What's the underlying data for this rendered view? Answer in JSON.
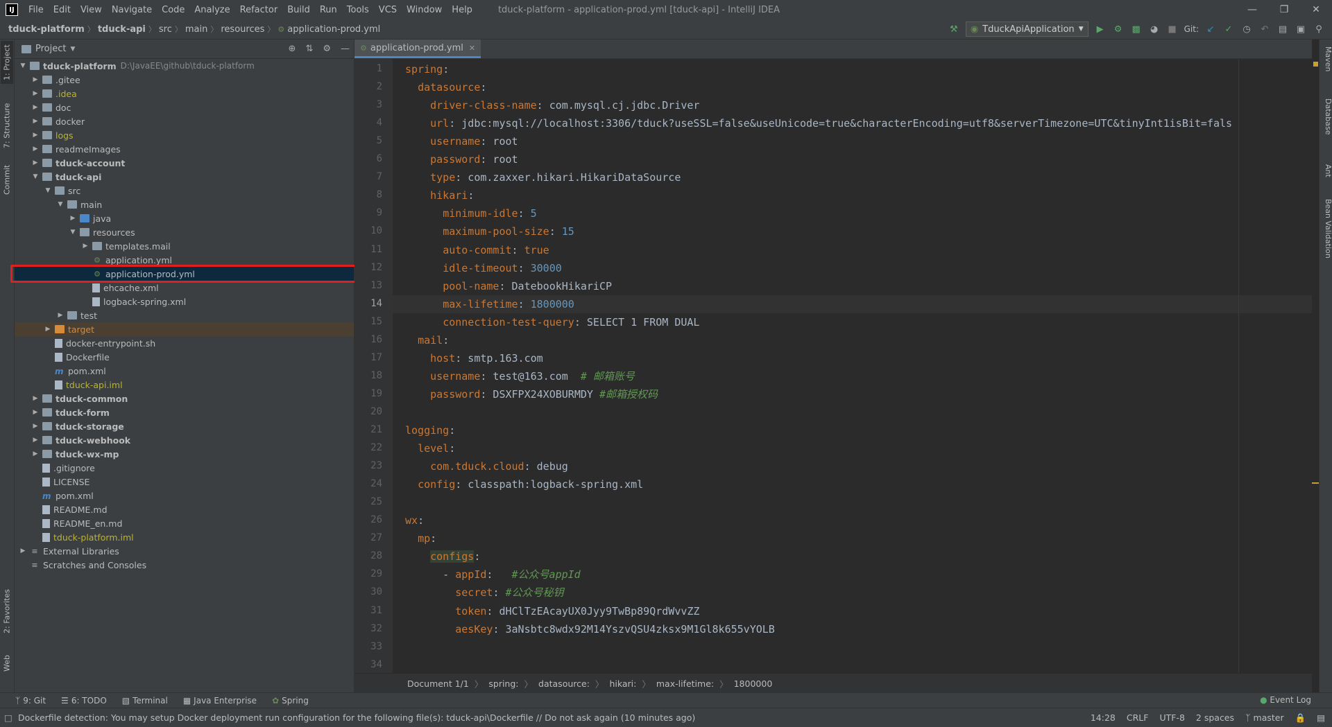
{
  "window": {
    "logo": "IJ",
    "title": "tduck-platform - application-prod.yml [tduck-api] - IntelliJ IDEA",
    "menu": [
      "File",
      "Edit",
      "View",
      "Navigate",
      "Code",
      "Analyze",
      "Refactor",
      "Build",
      "Run",
      "Tools",
      "VCS",
      "Window",
      "Help"
    ]
  },
  "navbar": {
    "crumbs": [
      "tduck-platform",
      "tduck-api",
      "src",
      "main",
      "resources",
      "application-prod.yml"
    ],
    "run_config": "TduckApiApplication",
    "git_label": "Git:"
  },
  "left_strip": {
    "tabs": [
      "1: Project",
      "7: Structure",
      "Commit",
      "2: Favorites",
      "Web"
    ]
  },
  "right_strip": {
    "tabs": [
      "Maven",
      "Database",
      "Ant",
      "Bean Validation"
    ]
  },
  "project": {
    "title": "Project",
    "tree": [
      {
        "depth": 0,
        "arrow": "open",
        "icon": "folder",
        "name": "tduck-platform",
        "style": "bold",
        "extra": "D:\\JavaEE\\github\\tduck-platform"
      },
      {
        "depth": 1,
        "arrow": "closed",
        "icon": "folder",
        "name": ".gitee"
      },
      {
        "depth": 1,
        "arrow": "closed",
        "icon": "folder",
        "name": ".idea",
        "style": "olive"
      },
      {
        "depth": 1,
        "arrow": "closed",
        "icon": "folder",
        "name": "doc"
      },
      {
        "depth": 1,
        "arrow": "closed",
        "icon": "folder",
        "name": "docker"
      },
      {
        "depth": 1,
        "arrow": "closed",
        "icon": "folder",
        "name": "logs",
        "style": "olive"
      },
      {
        "depth": 1,
        "arrow": "closed",
        "icon": "folder",
        "name": "readmeImages"
      },
      {
        "depth": 1,
        "arrow": "closed",
        "icon": "folder",
        "name": "tduck-account",
        "style": "bold"
      },
      {
        "depth": 1,
        "arrow": "open",
        "icon": "folder",
        "name": "tduck-api",
        "style": "bold"
      },
      {
        "depth": 2,
        "arrow": "open",
        "icon": "folder",
        "name": "src"
      },
      {
        "depth": 3,
        "arrow": "open",
        "icon": "folder",
        "name": "main"
      },
      {
        "depth": 4,
        "arrow": "closed",
        "icon": "src",
        "name": "java"
      },
      {
        "depth": 4,
        "arrow": "open",
        "icon": "folder",
        "name": "resources"
      },
      {
        "depth": 5,
        "arrow": "closed",
        "icon": "folder",
        "name": "templates.mail"
      },
      {
        "depth": 5,
        "arrow": "none",
        "icon": "yml",
        "name": "application.yml"
      },
      {
        "depth": 5,
        "arrow": "none",
        "icon": "yml",
        "name": "application-prod.yml",
        "selected": true
      },
      {
        "depth": 5,
        "arrow": "none",
        "icon": "file",
        "name": "ehcache.xml"
      },
      {
        "depth": 5,
        "arrow": "none",
        "icon": "file",
        "name": "logback-spring.xml"
      },
      {
        "depth": 3,
        "arrow": "closed",
        "icon": "folder",
        "name": "test"
      },
      {
        "depth": 2,
        "arrow": "closed",
        "icon": "orange",
        "name": "target",
        "style": "orange",
        "target": true
      },
      {
        "depth": 2,
        "arrow": "none",
        "icon": "file",
        "name": "docker-entrypoint.sh"
      },
      {
        "depth": 2,
        "arrow": "none",
        "icon": "file",
        "name": "Dockerfile"
      },
      {
        "depth": 2,
        "arrow": "none",
        "icon": "m",
        "name": "pom.xml"
      },
      {
        "depth": 2,
        "arrow": "none",
        "icon": "file",
        "name": "tduck-api.iml",
        "style": "olive"
      },
      {
        "depth": 1,
        "arrow": "closed",
        "icon": "folder",
        "name": "tduck-common",
        "style": "bold"
      },
      {
        "depth": 1,
        "arrow": "closed",
        "icon": "folder",
        "name": "tduck-form",
        "style": "bold"
      },
      {
        "depth": 1,
        "arrow": "closed",
        "icon": "folder",
        "name": "tduck-storage",
        "style": "bold"
      },
      {
        "depth": 1,
        "arrow": "closed",
        "icon": "folder",
        "name": "tduck-webhook",
        "style": "bold"
      },
      {
        "depth": 1,
        "arrow": "closed",
        "icon": "folder",
        "name": "tduck-wx-mp",
        "style": "bold"
      },
      {
        "depth": 1,
        "arrow": "none",
        "icon": "file",
        "name": ".gitignore"
      },
      {
        "depth": 1,
        "arrow": "none",
        "icon": "file",
        "name": "LICENSE"
      },
      {
        "depth": 1,
        "arrow": "none",
        "icon": "m",
        "name": "pom.xml"
      },
      {
        "depth": 1,
        "arrow": "none",
        "icon": "file",
        "name": "README.md"
      },
      {
        "depth": 1,
        "arrow": "none",
        "icon": "file",
        "name": "README_en.md"
      },
      {
        "depth": 1,
        "arrow": "none",
        "icon": "file",
        "name": "tduck-platform.iml",
        "style": "olive"
      },
      {
        "depth": 0,
        "arrow": "closed",
        "icon": "lib",
        "name": "External Libraries"
      },
      {
        "depth": 0,
        "arrow": "none",
        "icon": "lib",
        "name": "Scratches and Consoles"
      }
    ]
  },
  "editor": {
    "tab": "application-prod.yml",
    "current_line": 14,
    "lines": [
      [
        [
          "k",
          "spring"
        ],
        [
          "v",
          ":"
        ]
      ],
      [
        [
          "v",
          "  "
        ],
        [
          "k",
          "datasource"
        ],
        [
          "v",
          ":"
        ]
      ],
      [
        [
          "v",
          "    "
        ],
        [
          "k",
          "driver-class-name"
        ],
        [
          "v",
          ": com.mysql.cj.jdbc.Driver"
        ]
      ],
      [
        [
          "v",
          "    "
        ],
        [
          "k",
          "url"
        ],
        [
          "v",
          ": jdbc:mysql://localhost:3306/tduck?useSSL=false&useUnicode=true&characterEncoding=utf8&serverTimezone=UTC&tinyInt1isBit=fals"
        ]
      ],
      [
        [
          "v",
          "    "
        ],
        [
          "k",
          "username"
        ],
        [
          "v",
          ": root"
        ]
      ],
      [
        [
          "v",
          "    "
        ],
        [
          "k",
          "password"
        ],
        [
          "v",
          ": root"
        ]
      ],
      [
        [
          "v",
          "    "
        ],
        [
          "k",
          "type"
        ],
        [
          "v",
          ": com.zaxxer.hikari.HikariDataSource"
        ]
      ],
      [
        [
          "v",
          "    "
        ],
        [
          "k",
          "hikari"
        ],
        [
          "v",
          ":"
        ]
      ],
      [
        [
          "v",
          "      "
        ],
        [
          "k",
          "minimum-idle"
        ],
        [
          "v",
          ": "
        ],
        [
          "n",
          "5"
        ]
      ],
      [
        [
          "v",
          "      "
        ],
        [
          "k",
          "maximum-pool-size"
        ],
        [
          "v",
          ": "
        ],
        [
          "n",
          "15"
        ]
      ],
      [
        [
          "v",
          "      "
        ],
        [
          "k",
          "auto-commit"
        ],
        [
          "v",
          ": "
        ],
        [
          "k",
          "true"
        ]
      ],
      [
        [
          "v",
          "      "
        ],
        [
          "k",
          "idle-timeout"
        ],
        [
          "v",
          ": "
        ],
        [
          "n",
          "30000"
        ]
      ],
      [
        [
          "v",
          "      "
        ],
        [
          "k",
          "pool-name"
        ],
        [
          "v",
          ": DatebookHikariCP"
        ]
      ],
      [
        [
          "v",
          "      "
        ],
        [
          "k",
          "max-lifetime"
        ],
        [
          "v",
          ": "
        ],
        [
          "n",
          "1800000"
        ]
      ],
      [
        [
          "v",
          "      "
        ],
        [
          "k",
          "connection-test-query"
        ],
        [
          "v",
          ": SELECT 1 FROM DUAL"
        ]
      ],
      [
        [
          "v",
          "  "
        ],
        [
          "k",
          "mail"
        ],
        [
          "v",
          ":"
        ]
      ],
      [
        [
          "v",
          "    "
        ],
        [
          "k",
          "host"
        ],
        [
          "v",
          ": smtp.163.com"
        ]
      ],
      [
        [
          "v",
          "    "
        ],
        [
          "k",
          "username"
        ],
        [
          "v",
          ": test@163.com  "
        ],
        [
          "c",
          "# 邮箱账号"
        ]
      ],
      [
        [
          "v",
          "    "
        ],
        [
          "k",
          "password"
        ],
        [
          "v",
          ": DSXFPX24XOBURMDY "
        ],
        [
          "c",
          "#邮箱授权码"
        ]
      ],
      [
        [
          "v",
          ""
        ]
      ],
      [
        [
          "k",
          "logging"
        ],
        [
          "v",
          ":"
        ]
      ],
      [
        [
          "v",
          "  "
        ],
        [
          "k",
          "level"
        ],
        [
          "v",
          ":"
        ]
      ],
      [
        [
          "v",
          "    "
        ],
        [
          "k",
          "com.tduck.cloud"
        ],
        [
          "v",
          ": "
        ],
        [
          "v",
          "debug"
        ]
      ],
      [
        [
          "v",
          "  "
        ],
        [
          "k",
          "config"
        ],
        [
          "v",
          ": classpath:logback-spring.xml"
        ]
      ],
      [
        [
          "v",
          ""
        ]
      ],
      [
        [
          "k",
          "wx"
        ],
        [
          "v",
          ":"
        ]
      ],
      [
        [
          "v",
          "  "
        ],
        [
          "k",
          "mp"
        ],
        [
          "v",
          ":"
        ]
      ],
      [
        [
          "v",
          "    "
        ],
        [
          "h",
          "configs"
        ],
        [
          "v",
          ":"
        ]
      ],
      [
        [
          "v",
          "      - "
        ],
        [
          "k",
          "appId"
        ],
        [
          "v",
          ":   "
        ],
        [
          "c",
          "#公众号appId"
        ]
      ],
      [
        [
          "v",
          "        "
        ],
        [
          "k",
          "secret"
        ],
        [
          "v",
          ": "
        ],
        [
          "c",
          "#公众号秘钥"
        ]
      ],
      [
        [
          "v",
          "        "
        ],
        [
          "k",
          "token"
        ],
        [
          "v",
          ": dHClTzEAcayUX0Jyy9TwBp89QrdWvvZZ"
        ]
      ],
      [
        [
          "v",
          "        "
        ],
        [
          "k",
          "aesKey"
        ],
        [
          "v",
          ": 3aNsbtc8wdx92M14YszvQSU4zksx9M1Gl8k655vYOLB"
        ]
      ],
      [
        [
          "v",
          ""
        ]
      ],
      [
        [
          "v",
          ""
        ]
      ]
    ],
    "breadcrumb": [
      "Document 1/1",
      "spring:",
      "datasource:",
      "hikari:",
      "max-lifetime:",
      "1800000"
    ]
  },
  "toolwindows": {
    "items": [
      "9: Git",
      "6: TODO",
      "Terminal",
      "Java Enterprise",
      "Spring"
    ],
    "event_log": "Event Log"
  },
  "status": {
    "message": "Dockerfile detection: You may setup Docker deployment run configuration for the following file(s): tduck-api\\Dockerfile // Do not ask again (10 minutes ago)",
    "position": "14:28",
    "line_sep": "CRLF",
    "encoding": "UTF-8",
    "indent": "2 spaces",
    "branch": "master"
  }
}
